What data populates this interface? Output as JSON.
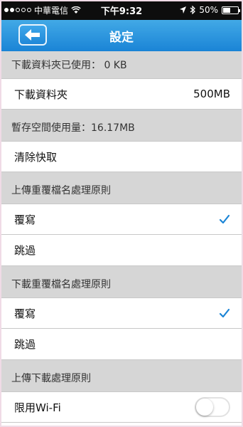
{
  "status_bar": {
    "carrier": "中華電信",
    "time": "下午9:32",
    "battery": "50%",
    "battery_level": 0.5
  },
  "nav": {
    "title": "設定",
    "back_icon": "back-arrow-icon"
  },
  "sections": {
    "download_folder": {
      "header": "下載資料夾已使用： 0 KB",
      "row_label": "下載資料夾",
      "row_value": "500MB"
    },
    "temp_storage": {
      "header": "暫存空間使用量：16.17MB",
      "row_label": "清除快取"
    },
    "upload_duplicate": {
      "header": "上傳重覆檔名處理原則",
      "options": [
        "覆寫",
        "跳過"
      ],
      "selected": "覆寫"
    },
    "download_duplicate": {
      "header": "下載重覆檔名處理原則",
      "options": [
        "覆寫",
        "跳過"
      ],
      "selected": "覆寫"
    },
    "transfer": {
      "header": "上傳下載處理原則",
      "row_label": "限用Wi-Fi",
      "wifi_only": false
    }
  },
  "colors": {
    "accent": "#1a84d6",
    "section_bg": "#d6d6d6"
  }
}
